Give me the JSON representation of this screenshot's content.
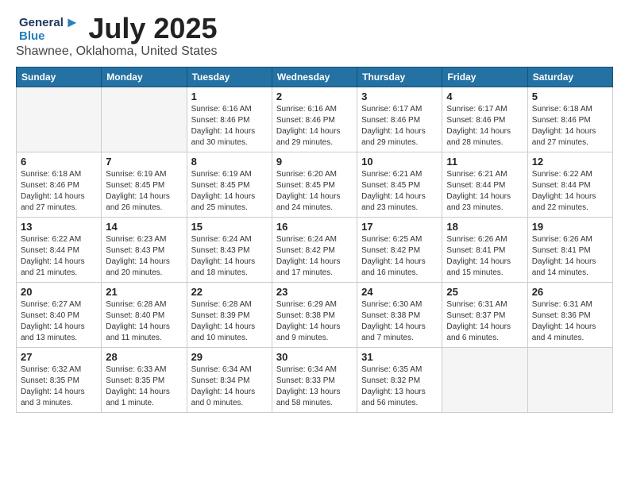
{
  "logo": {
    "line1": "General",
    "line2": "Blue"
  },
  "title": "July 2025",
  "subtitle": "Shawnee, Oklahoma, United States",
  "days_header": [
    "Sunday",
    "Monday",
    "Tuesday",
    "Wednesday",
    "Thursday",
    "Friday",
    "Saturday"
  ],
  "weeks": [
    [
      {
        "day": "",
        "info": ""
      },
      {
        "day": "",
        "info": ""
      },
      {
        "day": "1",
        "info": "Sunrise: 6:16 AM\nSunset: 8:46 PM\nDaylight: 14 hours\nand 30 minutes."
      },
      {
        "day": "2",
        "info": "Sunrise: 6:16 AM\nSunset: 8:46 PM\nDaylight: 14 hours\nand 29 minutes."
      },
      {
        "day": "3",
        "info": "Sunrise: 6:17 AM\nSunset: 8:46 PM\nDaylight: 14 hours\nand 29 minutes."
      },
      {
        "day": "4",
        "info": "Sunrise: 6:17 AM\nSunset: 8:46 PM\nDaylight: 14 hours\nand 28 minutes."
      },
      {
        "day": "5",
        "info": "Sunrise: 6:18 AM\nSunset: 8:46 PM\nDaylight: 14 hours\nand 27 minutes."
      }
    ],
    [
      {
        "day": "6",
        "info": "Sunrise: 6:18 AM\nSunset: 8:46 PM\nDaylight: 14 hours\nand 27 minutes."
      },
      {
        "day": "7",
        "info": "Sunrise: 6:19 AM\nSunset: 8:45 PM\nDaylight: 14 hours\nand 26 minutes."
      },
      {
        "day": "8",
        "info": "Sunrise: 6:19 AM\nSunset: 8:45 PM\nDaylight: 14 hours\nand 25 minutes."
      },
      {
        "day": "9",
        "info": "Sunrise: 6:20 AM\nSunset: 8:45 PM\nDaylight: 14 hours\nand 24 minutes."
      },
      {
        "day": "10",
        "info": "Sunrise: 6:21 AM\nSunset: 8:45 PM\nDaylight: 14 hours\nand 23 minutes."
      },
      {
        "day": "11",
        "info": "Sunrise: 6:21 AM\nSunset: 8:44 PM\nDaylight: 14 hours\nand 23 minutes."
      },
      {
        "day": "12",
        "info": "Sunrise: 6:22 AM\nSunset: 8:44 PM\nDaylight: 14 hours\nand 22 minutes."
      }
    ],
    [
      {
        "day": "13",
        "info": "Sunrise: 6:22 AM\nSunset: 8:44 PM\nDaylight: 14 hours\nand 21 minutes."
      },
      {
        "day": "14",
        "info": "Sunrise: 6:23 AM\nSunset: 8:43 PM\nDaylight: 14 hours\nand 20 minutes."
      },
      {
        "day": "15",
        "info": "Sunrise: 6:24 AM\nSunset: 8:43 PM\nDaylight: 14 hours\nand 18 minutes."
      },
      {
        "day": "16",
        "info": "Sunrise: 6:24 AM\nSunset: 8:42 PM\nDaylight: 14 hours\nand 17 minutes."
      },
      {
        "day": "17",
        "info": "Sunrise: 6:25 AM\nSunset: 8:42 PM\nDaylight: 14 hours\nand 16 minutes."
      },
      {
        "day": "18",
        "info": "Sunrise: 6:26 AM\nSunset: 8:41 PM\nDaylight: 14 hours\nand 15 minutes."
      },
      {
        "day": "19",
        "info": "Sunrise: 6:26 AM\nSunset: 8:41 PM\nDaylight: 14 hours\nand 14 minutes."
      }
    ],
    [
      {
        "day": "20",
        "info": "Sunrise: 6:27 AM\nSunset: 8:40 PM\nDaylight: 14 hours\nand 13 minutes."
      },
      {
        "day": "21",
        "info": "Sunrise: 6:28 AM\nSunset: 8:40 PM\nDaylight: 14 hours\nand 11 minutes."
      },
      {
        "day": "22",
        "info": "Sunrise: 6:28 AM\nSunset: 8:39 PM\nDaylight: 14 hours\nand 10 minutes."
      },
      {
        "day": "23",
        "info": "Sunrise: 6:29 AM\nSunset: 8:38 PM\nDaylight: 14 hours\nand 9 minutes."
      },
      {
        "day": "24",
        "info": "Sunrise: 6:30 AM\nSunset: 8:38 PM\nDaylight: 14 hours\nand 7 minutes."
      },
      {
        "day": "25",
        "info": "Sunrise: 6:31 AM\nSunset: 8:37 PM\nDaylight: 14 hours\nand 6 minutes."
      },
      {
        "day": "26",
        "info": "Sunrise: 6:31 AM\nSunset: 8:36 PM\nDaylight: 14 hours\nand 4 minutes."
      }
    ],
    [
      {
        "day": "27",
        "info": "Sunrise: 6:32 AM\nSunset: 8:35 PM\nDaylight: 14 hours\nand 3 minutes."
      },
      {
        "day": "28",
        "info": "Sunrise: 6:33 AM\nSunset: 8:35 PM\nDaylight: 14 hours\nand 1 minute."
      },
      {
        "day": "29",
        "info": "Sunrise: 6:34 AM\nSunset: 8:34 PM\nDaylight: 14 hours\nand 0 minutes."
      },
      {
        "day": "30",
        "info": "Sunrise: 6:34 AM\nSunset: 8:33 PM\nDaylight: 13 hours\nand 58 minutes."
      },
      {
        "day": "31",
        "info": "Sunrise: 6:35 AM\nSunset: 8:32 PM\nDaylight: 13 hours\nand 56 minutes."
      },
      {
        "day": "",
        "info": ""
      },
      {
        "day": "",
        "info": ""
      }
    ]
  ]
}
